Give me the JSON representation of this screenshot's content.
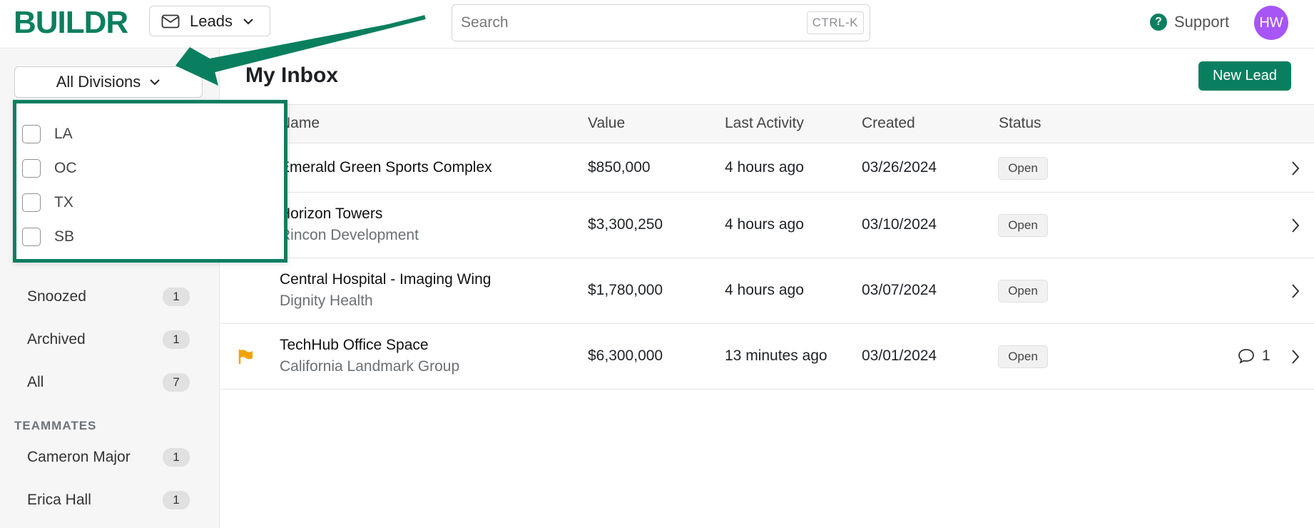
{
  "app": {
    "logo": "BUILDR"
  },
  "colors": {
    "brand": "#0a7f5f",
    "avatar": "#a855f7",
    "flag": "#f2a200",
    "help": "#0a7f5f"
  },
  "header": {
    "module_select": "Leads",
    "search": {
      "placeholder": "Search",
      "shortcut": "CTRL-K"
    },
    "support_label": "Support",
    "avatar_initials": "HW"
  },
  "sidebar": {
    "division_filter": "All Divisions",
    "items": [
      {
        "label": "Snoozed",
        "count": "1"
      },
      {
        "label": "Archived",
        "count": "1"
      },
      {
        "label": "All",
        "count": "7"
      }
    ],
    "teammates_label": "TEAMMATES",
    "teammates": [
      {
        "label": "Cameron Major",
        "count": "1"
      },
      {
        "label": "Erica Hall",
        "count": "1"
      }
    ]
  },
  "division_dropdown": {
    "options": [
      "LA",
      "OC",
      "TX",
      "SB"
    ]
  },
  "main": {
    "title": "My Inbox",
    "new_lead_label": "New Lead",
    "columns": [
      "Name",
      "Value",
      "Last Activity",
      "Created",
      "Status"
    ],
    "rows": [
      {
        "name": "Emerald Green Sports Complex",
        "company": "",
        "value": "$850,000",
        "last_activity": "4 hours ago",
        "created": "03/26/2024",
        "status": "Open",
        "flag": false,
        "comments": ""
      },
      {
        "name": "Horizon Towers",
        "company": "Rincon Development",
        "value": "$3,300,250",
        "last_activity": "4 hours ago",
        "created": "03/10/2024",
        "status": "Open",
        "flag": false,
        "comments": ""
      },
      {
        "name": "Central Hospital - Imaging Wing",
        "company": "Dignity Health",
        "value": "$1,780,000",
        "last_activity": "4 hours ago",
        "created": "03/07/2024",
        "status": "Open",
        "flag": false,
        "comments": ""
      },
      {
        "name": "TechHub Office Space",
        "company": "California Landmark Group",
        "value": "$6,300,000",
        "last_activity": "13 minutes ago",
        "created": "03/01/2024",
        "status": "Open",
        "flag": true,
        "comments": "1"
      }
    ]
  }
}
